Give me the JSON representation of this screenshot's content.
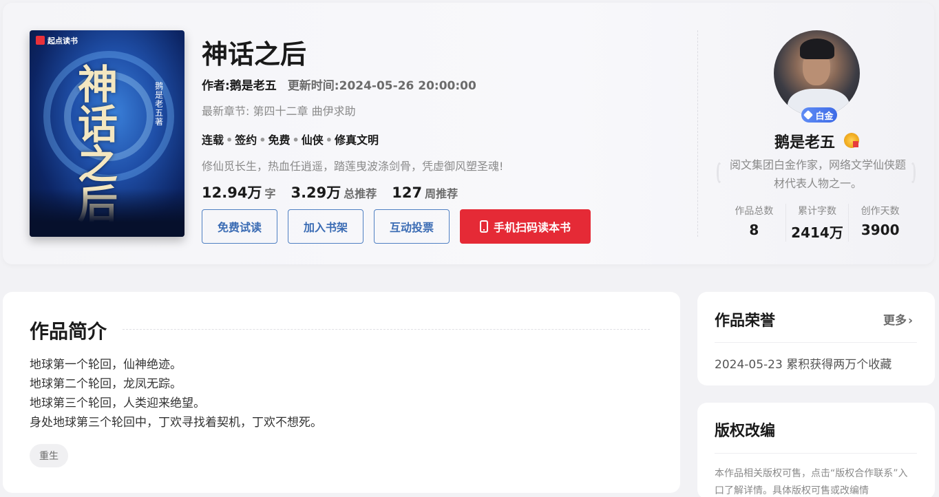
{
  "cover": {
    "logo_text": "起点读书",
    "title_art": "神话之后",
    "author_vertical": "鹅是老五 著"
  },
  "book": {
    "title": "神话之后",
    "author_label": "作者:鹅是老五",
    "update_label": "更新时间:2024-05-26 20:00:00",
    "latest_prefix": "最新章节: ",
    "latest_chapter": "第四十二章 曲伊求助",
    "tags": [
      "连载",
      "签约",
      "免费",
      "仙侠",
      "修真文明"
    ],
    "tagline": "修仙觅长生，热血任逍遥，踏莲曳波涤剑骨，凭虚御风塑圣魂!",
    "stats": [
      {
        "value": "12.94万",
        "unit": "字"
      },
      {
        "value": "3.29万",
        "unit": "总推荐"
      },
      {
        "value": "127",
        "unit": "周推荐"
      }
    ]
  },
  "buttons": {
    "free_read": "免费试读",
    "add_shelf": "加入书架",
    "vote": "互动投票",
    "scan": "手机扫码读本书"
  },
  "author": {
    "badge": "白金",
    "name": "鹅是老五",
    "desc": "阅文集团白金作家，网络文学仙侠题材代表人物之一。",
    "stats": [
      {
        "label": "作品总数",
        "value": "8"
      },
      {
        "label": "累计字数",
        "value": "2414万"
      },
      {
        "label": "创作天数",
        "value": "3900"
      }
    ]
  },
  "intro": {
    "heading": "作品简介",
    "lines": [
      "地球第一个轮回，仙神绝迹。",
      "地球第二个轮回，龙凤无踪。",
      "地球第三个轮回，人类迎来绝望。",
      "身处地球第三个轮回中，丁欢寻找着契机，丁欢不想死。"
    ],
    "tag": "重生"
  },
  "honor": {
    "title": "作品荣誉",
    "more": "更多",
    "item": "2024-05-23 累积获得两万个收藏"
  },
  "copyright": {
    "title": "版权改编",
    "text": "本作品相关版权可售，点击“版权合作联系”入口了解详情。具体版权可售或改编情"
  },
  "colors": {
    "accent_red": "#e52a36",
    "accent_blue": "#3b6cb4",
    "badge_blue": "#3e6be6"
  }
}
